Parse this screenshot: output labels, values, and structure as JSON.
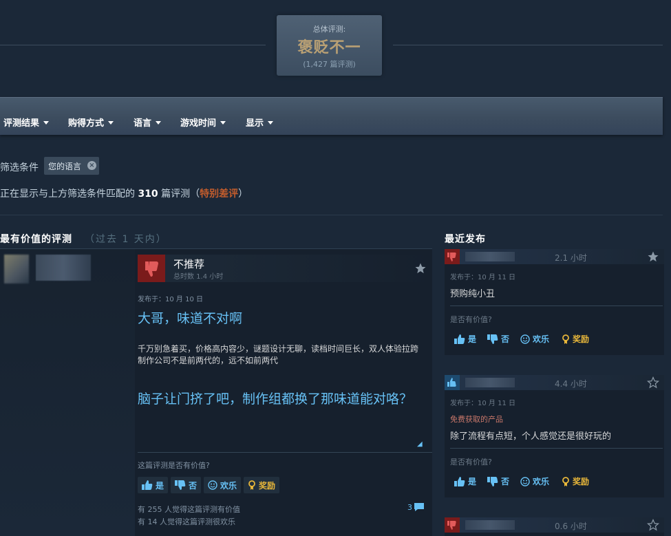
{
  "summary": {
    "label": "总体评测:",
    "score": "褒贬不一",
    "count": "(1,427 篇评测)"
  },
  "filters": {
    "items": [
      "评测结果",
      "购得方式",
      "语言",
      "游戏时间",
      "显示"
    ],
    "filters_label": "筛选条件",
    "chip": "您的语言",
    "showing_prefix": "正在显示与上方筛选条件匹配的",
    "showing_count": "310",
    "showing_mid": "篇评测（",
    "showing_rating": "特别差评",
    "showing_suffix": "）"
  },
  "left": {
    "title": "最有价值的评测",
    "subtitle": "（过去 1 天内）",
    "review": {
      "verdict": "不推荐",
      "hours": "总时数 1.4 小时",
      "posted": "发布于：10 月 10 日",
      "headline": "大哥，味道不对啊",
      "body": [
        "千万别急着买，价格高内容少，谜题设计无聊，读档时间巨长，双人体验拉跨",
        "制作公司不是前两代的，远不如前两代"
      ],
      "headline2": "脑子让门挤了吧，制作组都换了那味道能对咯？",
      "helpful_question": "这篇评测是否有价值?",
      "buttons": {
        "yes": "是",
        "no": "否",
        "funny": "欢乐",
        "award": "奖励"
      },
      "helpful_stat": "有 255 人觉得这篇评测有价值",
      "funny_stat": "有 14 人觉得这篇评测很欢乐",
      "comments": "3"
    }
  },
  "right": {
    "title": "最近发布",
    "cards": [
      {
        "verdict": "negative",
        "hours": "2.1 小时",
        "posted": "发布于：10 月 11 日",
        "free": "",
        "text": "预购纯小丑",
        "question": "是否有价值?"
      },
      {
        "verdict": "positive",
        "hours": "4.4 小时",
        "posted": "发布于：10 月 11 日",
        "free": "免费获取的产品",
        "text": "除了流程有点短，个人感觉还是很好玩的",
        "question": "是否有价值?"
      },
      {
        "verdict": "negative",
        "hours": "0.6 小时",
        "posted": "",
        "free": "",
        "text": "",
        "question": ""
      }
    ],
    "buttons": {
      "yes": "是",
      "no": "否",
      "funny": "欢乐",
      "award": "奖励"
    }
  },
  "colors": {
    "background": "#1b2838",
    "mixed_score": "#b9a074",
    "link_blue": "#67c1f5",
    "negative_orange": "#c35c2c",
    "thumb_down_red": "#c03a3a",
    "thumb_up_blue": "#4c9ad1"
  },
  "icons": [
    "thumbs-down-icon",
    "thumbs-up-icon",
    "star-icon",
    "smiley-icon",
    "award-icon",
    "comment-icon",
    "close-icon",
    "caret-down-icon"
  ]
}
